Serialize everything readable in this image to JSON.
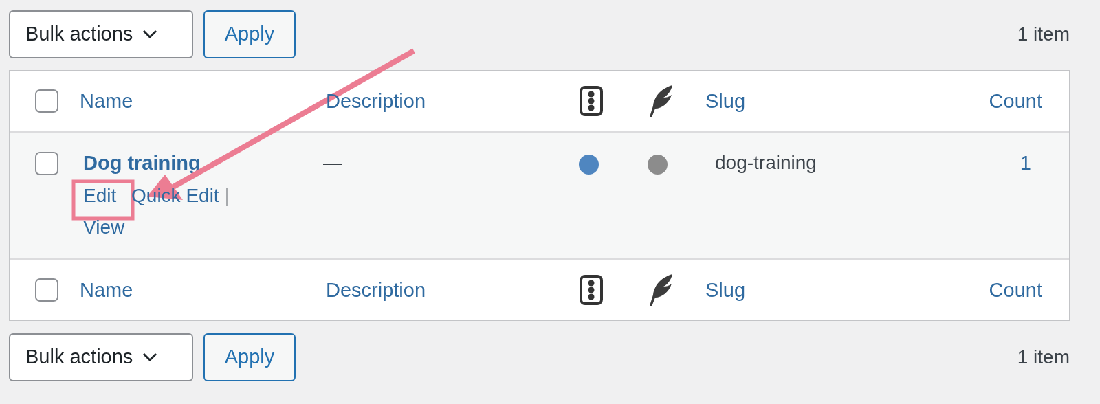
{
  "top_nav": {
    "bulk_actions": "Bulk actions",
    "apply": "Apply",
    "item_count": "1 item"
  },
  "table": {
    "header": {
      "checked": false,
      "columns": [
        {
          "kind": "text",
          "label": "Name"
        },
        {
          "kind": "text",
          "label": "Description"
        },
        {
          "kind": "traffic-icon"
        },
        {
          "kind": "feather-icon"
        },
        {
          "kind": "text",
          "label": "Slug"
        },
        {
          "kind": "text",
          "label": "Count"
        }
      ]
    },
    "rows": [
      {
        "checked": false,
        "name": "Dog training",
        "actions": [
          {
            "label": "Edit"
          },
          {
            "label": "Quick Edit",
            "separator": "|"
          },
          {
            "label": "View"
          }
        ],
        "description": "—",
        "seo_dot": {
          "color": "#4f86c0"
        },
        "readability_dot": {
          "color": "#8c8c8c"
        },
        "slug": "dog-training",
        "count": "1"
      }
    ],
    "footer": {
      "checked": false,
      "columns": [
        {
          "kind": "text",
          "label": "Name"
        },
        {
          "kind": "text",
          "label": "Description"
        },
        {
          "kind": "traffic-icon"
        },
        {
          "kind": "feather-icon"
        },
        {
          "kind": "text",
          "label": "Slug"
        },
        {
          "kind": "text",
          "label": "Count"
        }
      ]
    }
  },
  "bottom_nav": {
    "bulk_actions": "Bulk actions",
    "apply": "Apply",
    "item_count": "1 item"
  }
}
